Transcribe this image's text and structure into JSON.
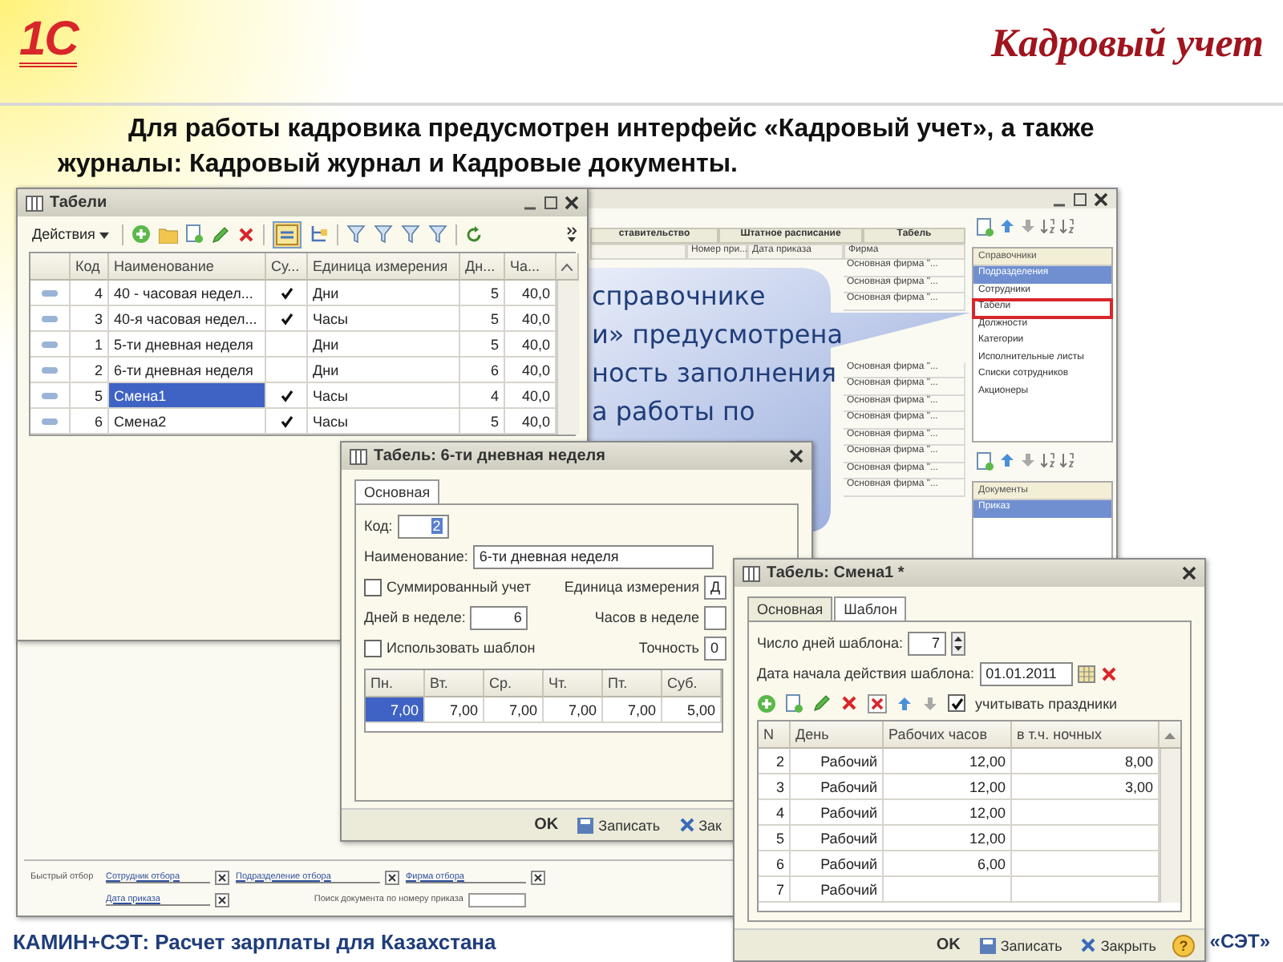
{
  "slide": {
    "logo": "1С",
    "title": "Кадровый учет",
    "intro": "Для работы кадровика предусмотрен интерфейс «Кадровый учет», а также журналы: Кадровый журнал и Кадровые документы.",
    "footer": "КАМИН+СЭТ: Расчет зарплаты для Казахстана",
    "brand": "«СЭТ»"
  },
  "journal": {
    "tabs": [
      "ставительство",
      "Штатное расписание",
      "Табель"
    ],
    "columns": [
      "Номер при...",
      "Дата приказа",
      "Фирма"
    ],
    "rows_above": [
      "Основная фирма \"...",
      "Основная фирма \"...",
      "Основная фирма \"..."
    ],
    "rows_below": [
      "Основная фирма \"...",
      "Основная фирма \"...",
      "Основная фирма \"...",
      "Основная фирма \"...",
      "Основная фирма \"...",
      "Основная фирма \"...",
      "Основная фирма \"...",
      "Основная фирма \"..."
    ],
    "sections": [
      {
        "title": "Справочники",
        "items": [
          {
            "label": "Подразделения",
            "selected": true,
            "outlined": false
          },
          {
            "label": "Сотрудники",
            "selected": false,
            "outlined": false
          },
          {
            "label": "Табели",
            "selected": false,
            "outlined": true
          },
          {
            "label": "Должности",
            "selected": false,
            "outlined": false
          },
          {
            "label": "Категории",
            "selected": false,
            "outlined": false
          },
          {
            "label": "Исполнительные листы",
            "selected": false,
            "outlined": false
          },
          {
            "label": "Списки сотрудников",
            "selected": false,
            "outlined": false
          },
          {
            "label": "Акционеры",
            "selected": false,
            "outlined": false
          }
        ]
      },
      {
        "title": "Документы",
        "items": [
          {
            "label": "Приказ",
            "selected": true,
            "outlined": false
          }
        ]
      }
    ],
    "filter": {
      "label": "Быстрый отбор",
      "links": [
        "Сотрудник отбора",
        "Подразделение отбора",
        "Фирма отбора",
        "Дата приказа"
      ],
      "search_label": "Поиск документа по номеру приказа"
    }
  },
  "callout": {
    "lines": [
      "справочнике",
      "и» предусмотрена",
      "ность заполнения",
      "а работы по"
    ]
  },
  "tabeli": {
    "title": "Табели",
    "actions": "Действия",
    "columns": [
      "Код",
      "Наименование",
      "Су...",
      "Единица измерения",
      "Дн...",
      "Ча..."
    ],
    "rows": [
      {
        "code": "4",
        "name": "40 - часовая недел...",
        "summed": true,
        "unit": "Дни",
        "days": "5",
        "hours": "40,0",
        "selected": false
      },
      {
        "code": "3",
        "name": "40-я часовая недел...",
        "summed": true,
        "unit": "Часы",
        "days": "5",
        "hours": "40,0",
        "selected": false
      },
      {
        "code": "1",
        "name": "5-ти дневная неделя",
        "summed": false,
        "unit": "Дни",
        "days": "5",
        "hours": "40,0",
        "selected": false
      },
      {
        "code": "2",
        "name": "6-ти дневная неделя",
        "summed": false,
        "unit": "Дни",
        "days": "6",
        "hours": "40,0",
        "selected": false
      },
      {
        "code": "5",
        "name": "Смена1",
        "summed": true,
        "unit": "Часы",
        "days": "4",
        "hours": "40,0",
        "selected": true
      },
      {
        "code": "6",
        "name": "Смена2",
        "summed": true,
        "unit": "Часы",
        "days": "5",
        "hours": "40,0",
        "selected": false
      }
    ]
  },
  "week_form": {
    "title": "Табель: 6-ти дневная неделя",
    "tab": "Основная",
    "code_label": "Код:",
    "code": "2",
    "name_label": "Наименование:",
    "name": "6-ти дневная неделя",
    "summed": {
      "label": "Суммированный учет",
      "checked": false
    },
    "unit_label": "Единица измерения",
    "unit": "Д",
    "days_label": "Дней в неделе:",
    "days": "6",
    "hours_label": "Часов в неделе",
    "template": {
      "label": "Использовать шаблон",
      "checked": false
    },
    "precision_label": "Точность",
    "precision": "0",
    "grid": [
      {
        "day": "Пн.",
        "value": "7,00",
        "selected": true
      },
      {
        "day": "Вт.",
        "value": "7,00",
        "selected": false
      },
      {
        "day": "Ср.",
        "value": "7,00",
        "selected": false
      },
      {
        "day": "Чт.",
        "value": "7,00",
        "selected": false
      },
      {
        "day": "Пт.",
        "value": "7,00",
        "selected": false
      },
      {
        "day": "Суб.",
        "value": "5,00",
        "selected": false
      }
    ],
    "buttons": [
      "OK",
      "Записать",
      "Зак"
    ]
  },
  "shift_form": {
    "title": "Табель: Смена1 *",
    "tabs": [
      {
        "label": "Основная",
        "selected": false
      },
      {
        "label": "Шаблон",
        "selected": true
      }
    ],
    "days_label": "Число дней шаблона:",
    "days": "7",
    "date_label": "Дата начала действия шаблона:",
    "date": "01.01.2011",
    "holidays": {
      "label": "учитывать праздники",
      "checked": true
    },
    "columns": [
      "N",
      "День",
      "Рабочих часов",
      "в т.ч. ночных"
    ],
    "rows": [
      {
        "n": "2",
        "day": "Рабочий",
        "hours": "12,00",
        "night": "8,00"
      },
      {
        "n": "3",
        "day": "Рабочий",
        "hours": "12,00",
        "night": "3,00"
      },
      {
        "n": "4",
        "day": "Рабочий",
        "hours": "12,00"
      },
      {
        "n": "5",
        "day": "Рабочий",
        "hours": "12,00"
      },
      {
        "n": "6",
        "day": "Рабочий",
        "hours": "6,00"
      },
      {
        "n": "7",
        "day": "Рабочий"
      }
    ],
    "buttons": [
      "OK",
      "Записать",
      "Закрыть"
    ],
    "help": "?"
  }
}
